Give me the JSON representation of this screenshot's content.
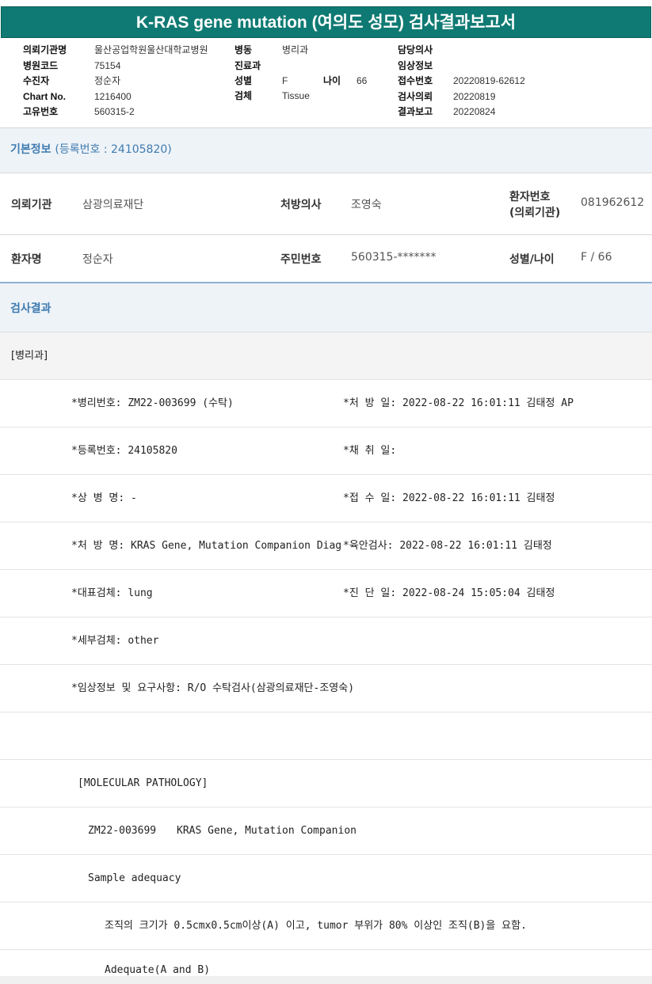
{
  "title": "K-RAS gene mutation (여의도 성모) 검사결과보고서",
  "header": {
    "col1": [
      {
        "label": "의뢰기관명",
        "value": "울산공업학원울산대학교병원"
      },
      {
        "label": "병원코드",
        "value": "75154"
      },
      {
        "label": "수진자",
        "value": "정순자"
      },
      {
        "label": "Chart No.",
        "value": "1216400"
      },
      {
        "label": "고유번호",
        "value": "560315-2"
      }
    ],
    "col2": [
      {
        "label": "병동",
        "value": "병리과"
      },
      {
        "label": "진료과",
        "value": ""
      },
      {
        "label": "성별",
        "value": "F"
      },
      {
        "label": "검체",
        "value": "Tissue"
      }
    ],
    "age": {
      "label": "나이",
      "value": "66"
    },
    "col3": [
      {
        "label": "담당의사",
        "value": ""
      },
      {
        "label": "임상정보",
        "value": ""
      },
      {
        "label": "접수번호",
        "value": "20220819-62612"
      },
      {
        "label": "검사의뢰",
        "value": "20220819"
      },
      {
        "label": "결과보고",
        "value": "20220824"
      }
    ]
  },
  "basic": {
    "heading": "기본정보",
    "reg": "(등록번호 : 24105820)",
    "row1": {
      "inst_label": "의뢰기관",
      "inst_value": "삼광의료재단",
      "doc_label": "처방의사",
      "doc_value": "조영숙",
      "pno_label_1": "환자번호",
      "pno_label_2": "(의뢰기관)",
      "pno_value": "081962612"
    },
    "row2": {
      "name_label": "환자명",
      "name_value": "정순자",
      "ssn_label": "주민번호",
      "ssn_value": "560315-*******",
      "sex_label": "성별/나이",
      "sex_value": "F / 66"
    }
  },
  "results": {
    "heading": "검사결과",
    "dept": "[병리과]",
    "rows": [
      {
        "left": "*병리번호: ZM22-003699 (수탁)",
        "right": "*처 방 일: 2022-08-22 16:01:11  김태정 AP"
      },
      {
        "left": "*등록번호: 24105820",
        "right": "*채 취 일:"
      },
      {
        "left": "*상 병 명: -",
        "right": "*접 수 일: 2022-08-22 16:01:11  김태정"
      },
      {
        "left": "*처 방 명: KRAS Gene, Mutation Companion Diagno",
        "right": "*육안검사: 2022-08-22 16:01:11  김태정"
      },
      {
        "left": "*대표검체: lung",
        "right": "*진 단 일: 2022-08-24 15:05:04  김태정"
      },
      {
        "left": "*세부검체: other",
        "right": ""
      },
      {
        "left": "*임상정보 및 요구사항: R/O 수탁검사(삼광의료재단-조영숙)",
        "right": ""
      }
    ],
    "molecular": "[MOLECULAR PATHOLOGY]",
    "test_id": "ZM22-003699",
    "test_name": "KRAS Gene, Mutation Companion",
    "sample": "Sample adequacy",
    "criteria": "조직의 크기가 0.5cmx0.5cm이상(A) 이고, tumor 부위가 80% 이상인 조직(B)을 요함.",
    "adequate": "Adequate(A and B)"
  }
}
